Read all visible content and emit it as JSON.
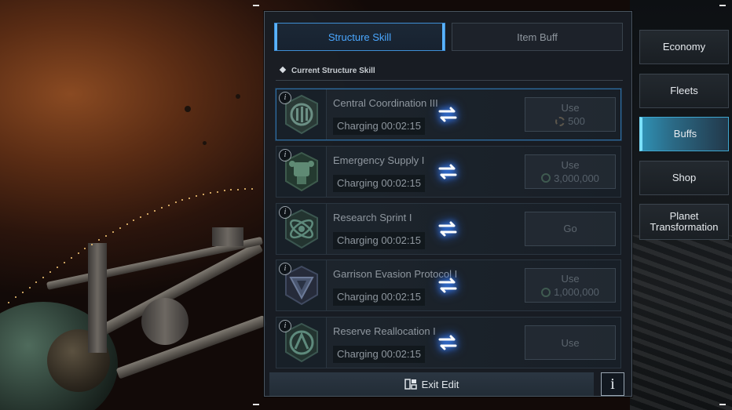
{
  "tabs": [
    {
      "label": "Structure Skill",
      "active": true
    },
    {
      "label": "Item Buff",
      "active": false
    }
  ],
  "section_title": "Current Structure Skill",
  "skills": [
    {
      "name": "Central Coordination III",
      "timer": "Charging 00:02:15",
      "button": "Use",
      "cost": "500",
      "cost_icon": "gear-icon",
      "highlight": true
    },
    {
      "name": "Emergency Supply I",
      "timer": "Charging 00:02:15",
      "button": "Use",
      "cost": "3,000,000",
      "cost_icon": "coin-icon",
      "highlight": false
    },
    {
      "name": "Research Sprint I",
      "timer": "Charging 00:02:15",
      "button": "Go",
      "cost": "",
      "cost_icon": "",
      "highlight": false
    },
    {
      "name": "Garrison Evasion Protocol I",
      "timer": "Charging 00:02:15",
      "button": "Use",
      "cost": "1,000,000",
      "cost_icon": "coin-icon",
      "highlight": false
    },
    {
      "name": "Reserve Reallocation I",
      "timer": "Charging 00:02:15",
      "button": "Use",
      "cost": "",
      "cost_icon": "",
      "highlight": false
    }
  ],
  "footer": {
    "exit_edit_label": "Exit Edit",
    "info_label": "i"
  },
  "side_nav": [
    {
      "label": "Economy",
      "active": false
    },
    {
      "label": "Fleets",
      "active": false
    },
    {
      "label": "Buffs",
      "active": true
    },
    {
      "label": "Shop",
      "active": false
    },
    {
      "label": "Planet Transformation",
      "active": false
    }
  ],
  "colors": {
    "accent": "#4aa7ff",
    "nav_active": "#2f8fb2",
    "swap_glow": "#3f8fff"
  }
}
